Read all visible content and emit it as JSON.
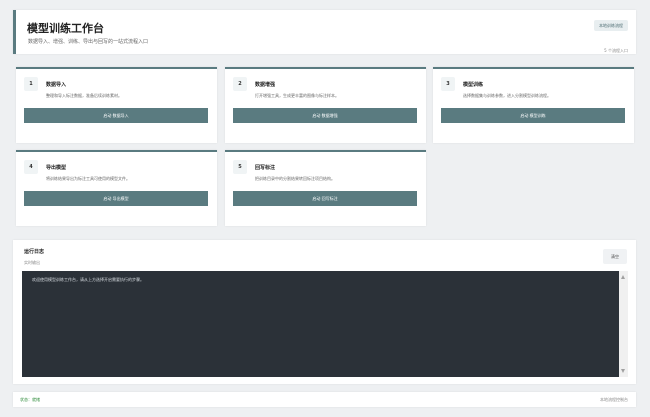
{
  "header": {
    "title": "模型训练工作台",
    "subtitle": "数据导入、增强、训练、导出与回写的一站式流程入口",
    "local_button": "本地训练流程",
    "module_count": "5 个流程入口"
  },
  "cards": [
    {
      "num": "1",
      "title": "数据导入",
      "desc": "整理和导入标注数据，准备后续训练素材。",
      "button": "启动 数据导入"
    },
    {
      "num": "2",
      "title": "数据增强",
      "desc": "打开增强工具，生成更丰富的图像与标注样本。",
      "button": "启动 数据增强"
    },
    {
      "num": "3",
      "title": "模型训练",
      "desc": "选择数据集与训练参数，进入分割模型训练流程。",
      "button": "启动 模型训练"
    },
    {
      "num": "4",
      "title": "导出模型",
      "desc": "将训练结果导出为标注工具可使用的模型文件。",
      "button": "启动 导出模型"
    },
    {
      "num": "5",
      "title": "回写标注",
      "desc": "把训练目录中的分割结果转回标注项目结构。",
      "button": "启动 回写标注"
    }
  ],
  "log": {
    "title": "运行日志",
    "subtitle": "实时输出",
    "clear_button": "清空",
    "text": "欢迎使用模型训练工作台，请从上方选择开启需要执行的步骤。"
  },
  "status": {
    "text": "状态：就绪",
    "flow": "本地流程控制台"
  }
}
